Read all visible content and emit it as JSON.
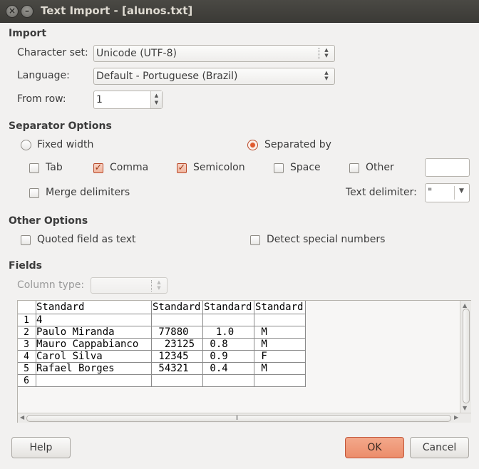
{
  "window": {
    "title": "Text Import - [alunos.txt]"
  },
  "import": {
    "heading": "Import",
    "charset_label": "Character set:",
    "charset_value": "Unicode (UTF-8)",
    "language_label": "Language:",
    "language_value": "Default - Portuguese (Brazil)",
    "from_row_label": "From row:",
    "from_row_value": "1"
  },
  "separator": {
    "heading": "Separator Options",
    "fixed_width": "Fixed width",
    "separated_by": "Separated by",
    "tab": "Tab",
    "comma": "Comma",
    "semicolon": "Semicolon",
    "space": "Space",
    "other": "Other",
    "merge": "Merge delimiters",
    "text_delim_label": "Text delimiter:",
    "text_delim_value": "\""
  },
  "other_options": {
    "heading": "Other Options",
    "quoted": "Quoted field as text",
    "detect": "Detect special numbers"
  },
  "fields": {
    "heading": "Fields",
    "column_type_label": "Column type:",
    "headers": [
      "Standard",
      "Standard",
      "Standard",
      "Standard"
    ],
    "row_numbers": [
      "1",
      "2",
      "3",
      "4",
      "5",
      "6"
    ],
    "rows": [
      [
        "4",
        "",
        "",
        ""
      ],
      [
        "Paulo Miranda",
        " 77880",
        "  1.0",
        " M"
      ],
      [
        "Mauro Cappabianco",
        "  23125",
        " 0.8",
        " M"
      ],
      [
        "Carol Silva",
        " 12345",
        " 0.9",
        " F"
      ],
      [
        "Rafael Borges",
        " 54321",
        " 0.4",
        " M"
      ],
      [
        "",
        "",
        "",
        ""
      ]
    ]
  },
  "buttons": {
    "help": "Help",
    "ok": "OK",
    "cancel": "Cancel"
  },
  "colors": {
    "accent": "#ec8d6b",
    "titlebar": "#3b3a36"
  }
}
